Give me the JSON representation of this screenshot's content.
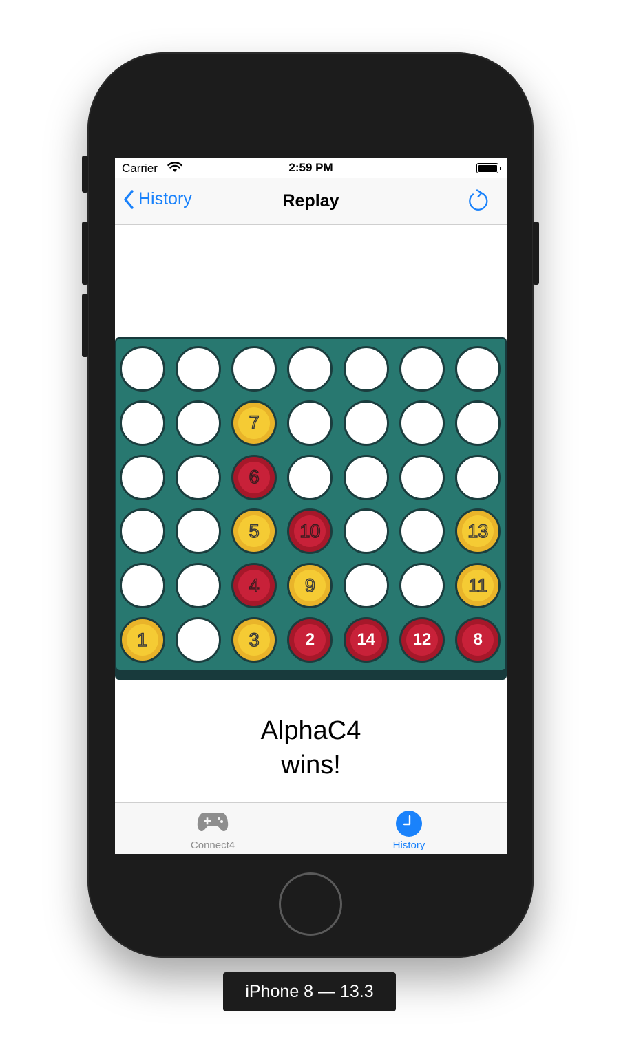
{
  "device": {
    "caption": "iPhone 8 — 13.3"
  },
  "status_bar": {
    "carrier": "Carrier",
    "time": "2:59 PM"
  },
  "nav": {
    "back_label": "History",
    "title": "Replay"
  },
  "board": {
    "rows": 6,
    "cols": 7,
    "moves": [
      {
        "n": "1",
        "color": "yellow",
        "row": 6,
        "col": 1
      },
      {
        "n": "2",
        "color": "red",
        "row": 6,
        "col": 4
      },
      {
        "n": "3",
        "color": "yellow",
        "row": 6,
        "col": 3
      },
      {
        "n": "4",
        "color": "red",
        "row": 5,
        "col": 3
      },
      {
        "n": "5",
        "color": "yellow",
        "row": 4,
        "col": 3
      },
      {
        "n": "6",
        "color": "red",
        "row": 3,
        "col": 3
      },
      {
        "n": "7",
        "color": "yellow",
        "row": 2,
        "col": 3
      },
      {
        "n": "8",
        "color": "red",
        "row": 6,
        "col": 7
      },
      {
        "n": "9",
        "color": "yellow",
        "row": 5,
        "col": 4
      },
      {
        "n": "10",
        "color": "red",
        "row": 4,
        "col": 4
      },
      {
        "n": "11",
        "color": "yellow",
        "row": 5,
        "col": 7
      },
      {
        "n": "12",
        "color": "red",
        "row": 6,
        "col": 6
      },
      {
        "n": "13",
        "color": "yellow",
        "row": 4,
        "col": 7
      },
      {
        "n": "14",
        "color": "red",
        "row": 6,
        "col": 5
      }
    ],
    "highlighted_moves": [
      "2",
      "14",
      "12",
      "8"
    ]
  },
  "result": {
    "line1": "AlphaC4",
    "line2": "wins!"
  },
  "tabs": [
    {
      "label": "Connect4",
      "icon": "gamecontroller-icon",
      "selected": false
    },
    {
      "label": "History",
      "icon": "clock-icon",
      "selected": true
    }
  ],
  "colors": {
    "accent": "#1a82fb",
    "board": "#287870",
    "yellow": "#f5cb34",
    "red": "#c82139",
    "tab_inactive": "#8e8e8e"
  }
}
